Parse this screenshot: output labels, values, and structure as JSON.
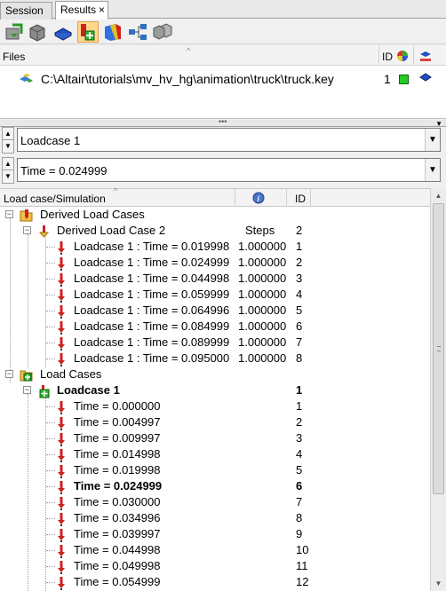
{
  "tabs": [
    {
      "label": "Session"
    },
    {
      "label": "Results",
      "close": "×"
    }
  ],
  "toolbar": {
    "icons": [
      "load-results-icon",
      "box-icon",
      "model-view-icon",
      "derived-loadcase-icon",
      "contour-icon",
      "connectivity-icon",
      "multi-box-icon"
    ],
    "active_index": 3
  },
  "files": {
    "header": "Files",
    "col_id": "ID",
    "path": "C:\\Altair\\tutorials\\mv_hv_hg\\animation\\truck\\truck.key",
    "id": "1",
    "color": "#22cc22"
  },
  "loadcase_combo": {
    "value": "Loadcase 1"
  },
  "time_combo": {
    "value": "Time = 0.024999"
  },
  "tree": {
    "col_loadcase": "Load case/Simulation",
    "col_id": "ID",
    "derived_group": "Derived Load Cases",
    "derived_case": {
      "label": "Derived Load Case 2",
      "steps": "Steps",
      "id": "2"
    },
    "derived_rows": [
      {
        "label": "Loadcase 1 : Time = 0.019998",
        "steps": "1.000000",
        "id": "1"
      },
      {
        "label": "Loadcase 1 : Time = 0.024999",
        "steps": "1.000000",
        "id": "2"
      },
      {
        "label": "Loadcase 1 : Time = 0.044998",
        "steps": "1.000000",
        "id": "3"
      },
      {
        "label": "Loadcase 1 : Time = 0.059999",
        "steps": "1.000000",
        "id": "4"
      },
      {
        "label": "Loadcase 1 : Time = 0.064996",
        "steps": "1.000000",
        "id": "5"
      },
      {
        "label": "Loadcase 1 : Time = 0.084999",
        "steps": "1.000000",
        "id": "6"
      },
      {
        "label": "Loadcase 1 : Time = 0.089999",
        "steps": "1.000000",
        "id": "7"
      },
      {
        "label": "Loadcase 1 : Time = 0.095000",
        "steps": "1.000000",
        "id": "8"
      }
    ],
    "load_group": "Load Cases",
    "loadcase": {
      "label": "Loadcase 1",
      "id": "1"
    },
    "time_rows": [
      {
        "label": "Time = 0.000000",
        "id": "1"
      },
      {
        "label": "Time = 0.004997",
        "id": "2"
      },
      {
        "label": "Time = 0.009997",
        "id": "3"
      },
      {
        "label": "Time = 0.014998",
        "id": "4"
      },
      {
        "label": "Time = 0.019998",
        "id": "5"
      },
      {
        "label": "Time = 0.024999",
        "id": "6",
        "current": true
      },
      {
        "label": "Time = 0.030000",
        "id": "7"
      },
      {
        "label": "Time = 0.034996",
        "id": "8"
      },
      {
        "label": "Time = 0.039997",
        "id": "9"
      },
      {
        "label": "Time = 0.044998",
        "id": "10"
      },
      {
        "label": "Time = 0.049998",
        "id": "11"
      },
      {
        "label": "Time = 0.054999",
        "id": "12"
      }
    ]
  }
}
